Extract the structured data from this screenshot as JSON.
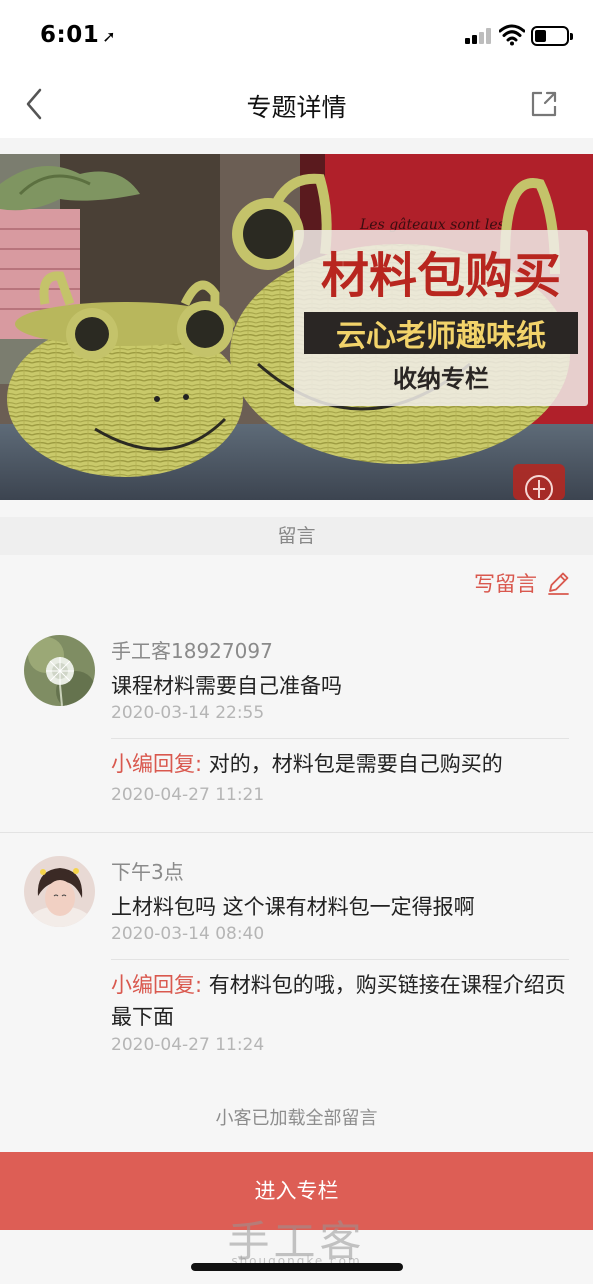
{
  "status_bar": {
    "time": "6:01",
    "icons": [
      "location-arrow-icon",
      "cellular-signal-icon",
      "wifi-icon",
      "battery-icon"
    ]
  },
  "nav": {
    "title": "专题详情",
    "back_icon": "chevron-left-icon",
    "share_icon": "share-icon"
  },
  "banner": {
    "title": "材料包购买",
    "subtitle": "云心老师趣味纸",
    "subtitle2": "收纳专栏",
    "bg_script": "Les gâteaux sont les",
    "logo_icon": "brand-logo-icon"
  },
  "comments": {
    "section_label": "留言",
    "write_label": "写留言",
    "write_icon": "pencil-icon",
    "items": [
      {
        "user": "手工客18927097",
        "text": "课程材料需要自己准备吗",
        "time": "2020-03-14 22:55",
        "reply_label": "小编回复:",
        "reply_text": "对的，材料包是需要自己购买的",
        "reply_time": "2020-04-27 11:21"
      },
      {
        "user": "下午3点",
        "text": "上材料包吗 这个课有材料包一定得报啊",
        "time": "2020-03-14 08:40",
        "reply_label": "小编回复:",
        "reply_text": "有材料包的哦，购买链接在课程介绍页最下面",
        "reply_time": "2020-04-27 11:24"
      }
    ],
    "loaded_all": "小客已加载全部留言"
  },
  "footer": {
    "enter_button": "进入专栏",
    "watermark": "手工客",
    "watermark_sub": "shougongke.com"
  },
  "colors": {
    "accent": "#d9584e",
    "button_bg": "#dd5e55"
  }
}
